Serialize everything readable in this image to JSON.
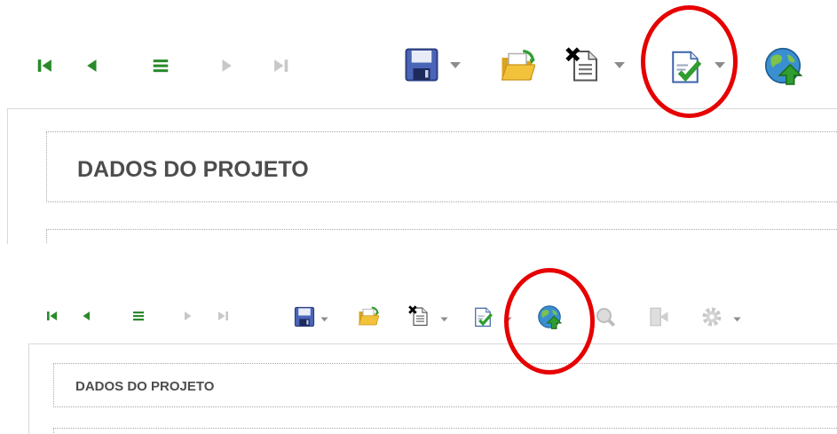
{
  "colors": {
    "nav_green": "#2a8a2a",
    "nav_disabled": "#c8c8c8",
    "title_text": "#4d4d4d",
    "highlight": "#e60000",
    "save_blue": "#4a64b8",
    "folder_yellow": "#f2c23b",
    "globe_blue": "#3a8fd1",
    "globe_arrow": "#2f9e2f"
  },
  "icons": {
    "first": "first-record-icon",
    "previous": "previous-record-icon",
    "list": "list-icon",
    "next": "next-record-icon",
    "last": "last-record-icon",
    "save": "save-icon",
    "open": "open-folder-icon",
    "new": "new-document-icon",
    "approve": "approve-document-icon",
    "publish": "publish-globe-icon",
    "search": "search-icon",
    "exit": "exit-icon",
    "settings": "gear-icon",
    "dropdown": "chevron-down-icon"
  },
  "top": {
    "section_title": "DADOS DO PROJETO",
    "highlighted_button": "approve-document"
  },
  "bottom": {
    "section_title": "DADOS DO PROJETO",
    "highlighted_button": "publish-globe"
  }
}
